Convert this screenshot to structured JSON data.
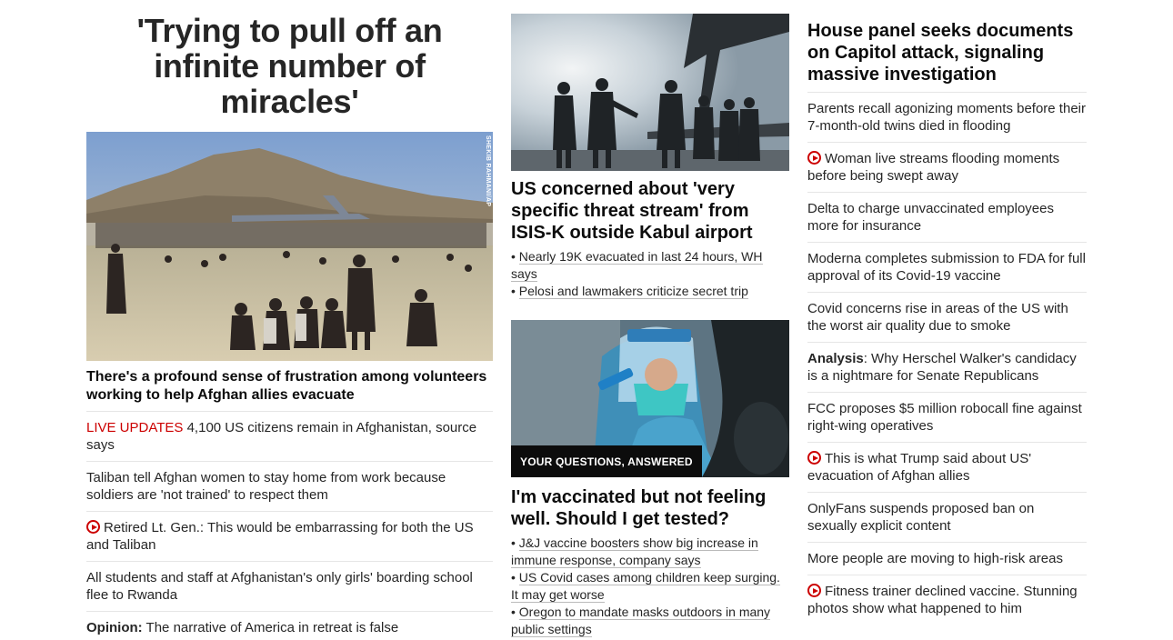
{
  "col1": {
    "headline": "'Trying to pull off an infinite number of miracles'",
    "photo_credit": "SHEKIB RAHMANI/AP",
    "lead": "There's a profound sense of frustration among volunteers working to help Afghan allies evacuate",
    "items": [
      {
        "prefix": "LIVE UPDATES",
        "text": " 4,100 US citizens remain in Afghanistan, source says"
      },
      {
        "text": "Taliban tell Afghan women to stay home from work because soldiers are 'not trained' to respect them"
      },
      {
        "text": "Retired Lt. Gen.: This would be embarrassing for both the US and Taliban",
        "video": true
      },
      {
        "text": "All students and staff at Afghanistan's only girls' boarding school flee to Rwanda"
      },
      {
        "prefix": "Opinion:",
        "text": " The narrative of America in retreat is false"
      }
    ]
  },
  "col2": {
    "story1": {
      "title": "US concerned about 'very specific threat stream' from ISIS-K outside Kabul airport",
      "bullets": [
        "Nearly 19K evacuated in last 24 hours, WH says",
        "Pelosi and lawmakers criticize secret trip"
      ]
    },
    "story2": {
      "tag": "YOUR QUESTIONS, ANSWERED",
      "title": "I'm vaccinated but not feeling well. Should I get tested?",
      "bullets": [
        "J&J vaccine boosters show big increase in immune response, company says",
        "US Covid cases among children keep surging. It may get worse",
        "Oregon to mandate masks outdoors in many public settings"
      ]
    }
  },
  "col3": {
    "title": "House panel seeks documents on Capitol attack, signaling massive investigation",
    "items": [
      {
        "text": "Parents recall agonizing moments before their 7-month-old twins died in flooding"
      },
      {
        "text": "Woman live streams flooding moments before being swept away",
        "video": true
      },
      {
        "text": "Delta to charge unvaccinated employees more for insurance"
      },
      {
        "text": "Moderna completes submission to FDA for full approval of its Covid-19 vaccine"
      },
      {
        "text": "Covid concerns rise in areas of the US with the worst air quality due to smoke"
      },
      {
        "prefix": "Analysis",
        "text": ": Why Herschel Walker's candidacy is a nightmare for Senate Republicans"
      },
      {
        "text": "FCC proposes $5 million robocall fine against right-wing operatives"
      },
      {
        "text": "This is what Trump said about US' evacuation of Afghan allies",
        "video": true
      },
      {
        "text": "OnlyFans suspends proposed ban on sexually explicit content"
      },
      {
        "text": "More people are moving to high-risk areas"
      },
      {
        "text": "Fitness trainer declined vaccine. Stunning photos show what happened to him",
        "video": true
      }
    ]
  },
  "colors": {
    "live": "#cc0000",
    "text": "#262626",
    "divider": "#e6e6e6"
  }
}
